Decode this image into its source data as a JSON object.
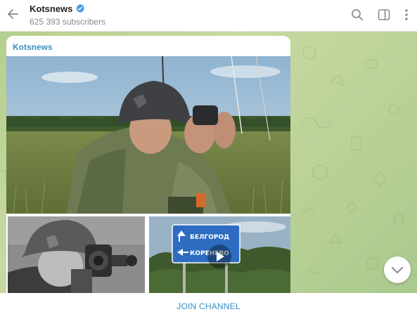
{
  "header": {
    "channel_name": "Kotsnews",
    "subscribers": "625 393 subscribers",
    "back_icon": "arrow-left-icon",
    "search_icon": "search-icon",
    "panel_icon": "sidebar-panel-icon",
    "more_icon": "more-vertical-icon"
  },
  "message": {
    "author": "Kotsnews",
    "sign": {
      "line1": "БЕЛГОРОД",
      "line2": "КОРЕНЕВО"
    }
  },
  "footer": {
    "join_label": "JOIN CHANNEL"
  },
  "colors": {
    "accent": "#3a8fc4",
    "verified": "#3d9ae8",
    "chat_background": "#b9d295",
    "sign_blue": "#2d6cc0"
  }
}
